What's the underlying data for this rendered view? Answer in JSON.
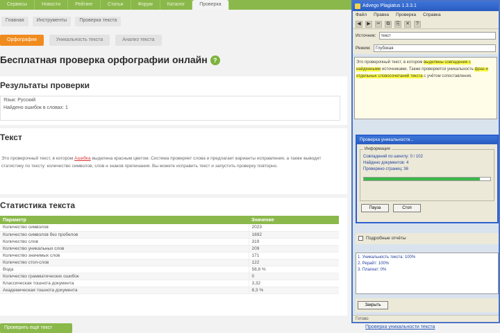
{
  "top_nav": {
    "items": [
      "Сервисы",
      "Новости",
      "Рейтинг",
      "Статьи",
      "Форум",
      "Каталог",
      "Проверка"
    ],
    "active_index": 6
  },
  "breadcrumbs": [
    "Главная",
    "Инструменты",
    "Проверка текста"
  ],
  "tabs": [
    "Орфография",
    "Уникальность текста",
    "Анализ текста"
  ],
  "page_title": "Бесплатная проверка орфографии онлайн",
  "results": {
    "title": "Результаты проверки",
    "line1": "Язык: Русский",
    "line2": "Найдено ошибок в словах: 1"
  },
  "text_section": {
    "title": "Текст",
    "before": "Это проверочный текст, в котором ",
    "error_word": "Ашибка",
    "after": " выделена красным цветом. Система проверяет слова и предлагает варианты исправления, а также выводит статистику по тексту: количество символов, слов и знаков препинания. Вы можете исправить текст и запустить проверку повторно."
  },
  "stats": {
    "title": "Статистика текста",
    "header": [
      "Параметр",
      "Значение"
    ],
    "rows": [
      [
        "Количество символов",
        "2023"
      ],
      [
        "Количество символов без пробелов",
        "1692"
      ],
      [
        "Количество слов",
        "319"
      ],
      [
        "Количество уникальных слов",
        "209"
      ],
      [
        "Количество значимых слов",
        "171"
      ],
      [
        "Количество стоп-слов",
        "122"
      ],
      [
        "Вода",
        "58,8 %"
      ],
      [
        "Количество грамматических ошибок",
        "0"
      ],
      [
        "Классическая тошнота документа",
        "3,32"
      ],
      [
        "Академическая тошнота документа",
        "8,3 %"
      ]
    ]
  },
  "bottom_button": "Проверить ещё текст",
  "app": {
    "title": "Advego Plagiatus 1.3.3.1",
    "menu": [
      "Файл",
      "Правка",
      "Проверка",
      "Справка"
    ],
    "toolbar": [
      "◀",
      "▶",
      "✂",
      "⧉",
      "⎘",
      "✕",
      "?"
    ],
    "field_label": "Источник:",
    "field_value": "текст",
    "mode_label": "Режим:",
    "mode_value": "Глубокая",
    "text_plain1": "Это проверочный текст, в котором ",
    "text_hl1": "выделены совпадения с найденными",
    "text_plain2": " источниками. Также проверяется уникальность ",
    "text_hl2": "фраз и отдельных словосочетаний текста",
    "text_plain3": " с учётом сопоставления.",
    "dialog_title": "Проверка уникальности...",
    "group_label": "Информация",
    "dialog_lines": [
      "Совпадений по шинглу: 0 / 102",
      "Найдено документов: 4",
      "Проверено страниц: 36"
    ],
    "progress": 0.92,
    "pause_btn": "Пауза",
    "stop_btn": "Стоп",
    "checkbox_label": "Подробные отчёты",
    "list_lines": [
      "1. Уникальность текста: 100%",
      "2. Рерайт: 100%",
      "3. Плагиат: 0%"
    ],
    "close_btn": "Закрыть",
    "status": "Готово"
  },
  "footer_link": "Проверка уникальности текста"
}
